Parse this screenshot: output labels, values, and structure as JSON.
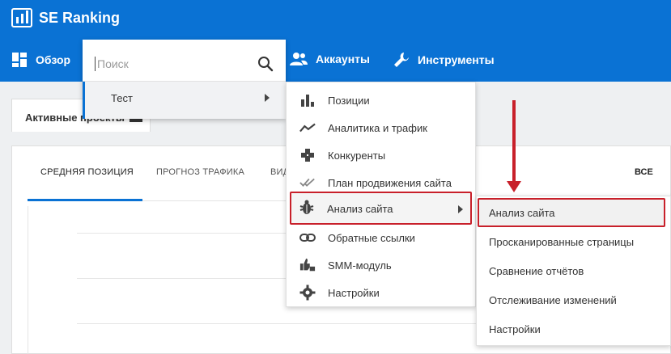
{
  "app": {
    "logo_text": "SE Ranking"
  },
  "nav": {
    "overview": "Обзор",
    "accounts": "Аккаунты",
    "tools": "Инструменты"
  },
  "search": {
    "placeholder": "Поиск",
    "project": "Тест"
  },
  "page": {
    "active_tab": "Активные проекты",
    "chart_tabs": [
      "СРЕДНЯЯ ПОЗИЦИЯ",
      "ПРОГНОЗ ТРАФИКА",
      "ВИД"
    ],
    "all_label": "ВСЕ"
  },
  "project_menu": {
    "items": [
      {
        "label": "Позиции",
        "icon": "bar-chart-icon"
      },
      {
        "label": "Аналитика и трафик",
        "icon": "trend-line-icon"
      },
      {
        "label": "Конкуренты",
        "icon": "gamepad-icon"
      },
      {
        "label": "План продвижения сайта",
        "icon": "double-check-icon"
      },
      {
        "label": "Анализ сайта",
        "icon": "bug-icon"
      },
      {
        "label": "Обратные ссылки",
        "icon": "link-icon"
      },
      {
        "label": "SMM-модуль",
        "icon": "thumbs-icon"
      },
      {
        "label": "Настройки",
        "icon": "gear-icon"
      }
    ]
  },
  "audit_submenu": {
    "items": [
      "Анализ сайта",
      "Просканированные страницы",
      "Сравнение отчётов",
      "Отслеживание изменений",
      "Настройки"
    ]
  },
  "colors": {
    "brand_blue": "#0a72d4",
    "annotation_red": "#c8202a"
  }
}
